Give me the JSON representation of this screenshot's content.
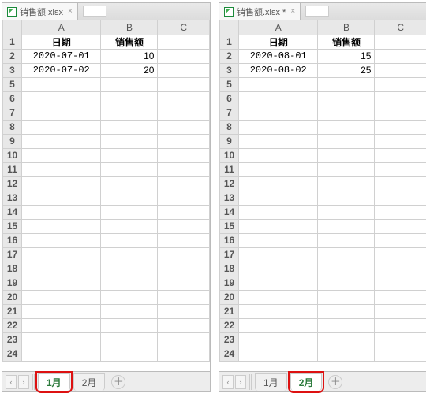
{
  "left": {
    "file_tab": "销售额.xlsx",
    "cols": [
      "A",
      "B",
      "C"
    ],
    "headers": {
      "A": "日期",
      "B": "销售额"
    },
    "rows": [
      {
        "n": "2",
        "A": "2020-07-01",
        "B": "10"
      },
      {
        "n": "3",
        "A": "2020-07-02",
        "B": "20"
      }
    ],
    "active_row": "18",
    "last_row": 24,
    "sheets": [
      "1月",
      "2月"
    ],
    "active_sheet": 0,
    "hl_sheet": 0
  },
  "right": {
    "file_tab": "销售额.xlsx *",
    "cols": [
      "A",
      "B",
      "C"
    ],
    "headers": {
      "A": "日期",
      "B": "销售额"
    },
    "rows": [
      {
        "n": "2",
        "A": "2020-08-01",
        "B": "15"
      },
      {
        "n": "3",
        "A": "2020-08-02",
        "B": "25"
      }
    ],
    "active_row": "22",
    "last_row": 24,
    "sheets": [
      "1月",
      "2月"
    ],
    "active_sheet": 1,
    "hl_sheet": 1
  },
  "nav": {
    "prev": "‹",
    "next": "›"
  },
  "add_icon": "＋",
  "close_icon": "×"
}
